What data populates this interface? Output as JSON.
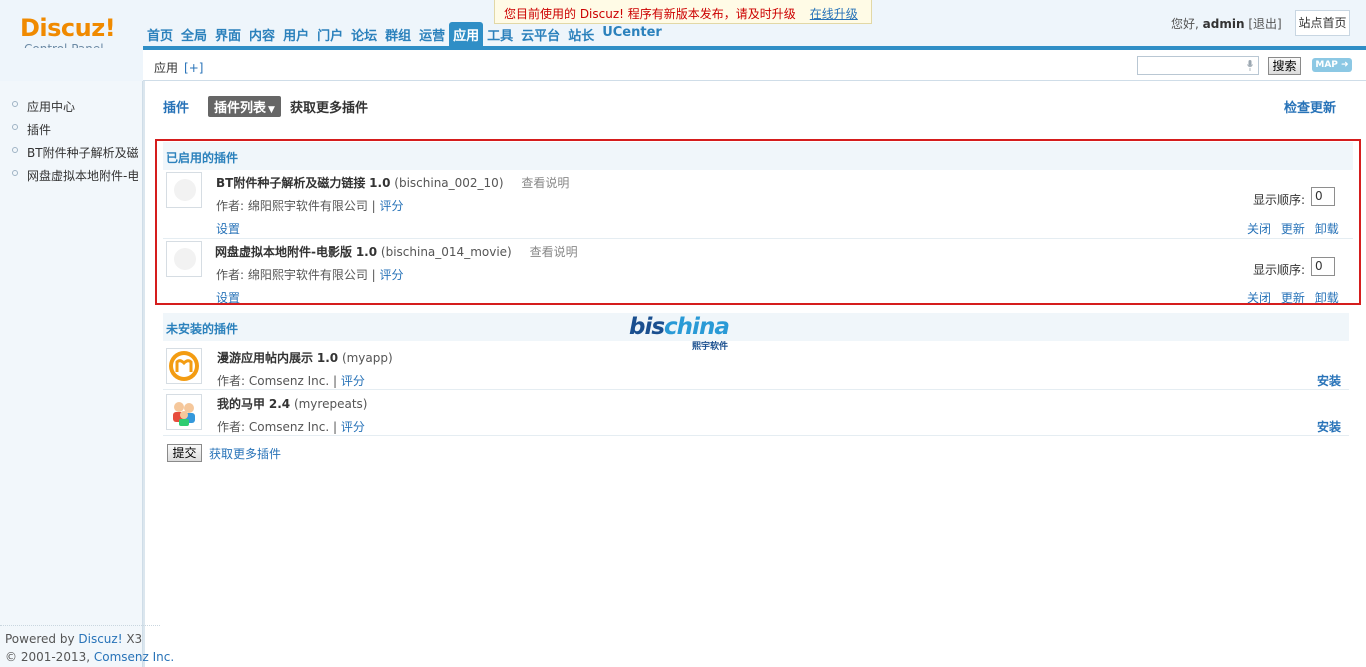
{
  "header": {
    "logo_brand": "Discuz!",
    "logo_sub": "Control Panel",
    "nav": [
      "首页",
      "全局",
      "界面",
      "内容",
      "用户",
      "门户",
      "论坛",
      "群组",
      "运营",
      "应用",
      "工具",
      "云平台",
      "站长",
      "UCenter"
    ],
    "active_nav": "应用",
    "notice_text": "您目前使用的 Discuz! 程序有新版本发布，请及时升级",
    "notice_link": "在线升级",
    "greeting": "您好,",
    "username": "admin",
    "logout": "[退出]",
    "home_link": "站点首页"
  },
  "subbar": {
    "crumb": "应用",
    "crumb_add": "[+]",
    "search_value": "",
    "search_button": "搜索",
    "map_button": "MAP ➜"
  },
  "sidebar": {
    "items": [
      "应用中心",
      "插件",
      "BT附件种子解析及磁",
      "网盘虚拟本地附件-电"
    ],
    "footer_line1_prefix": "Powered by ",
    "footer_line1_link": "Discuz!",
    "footer_line1_suffix": " X3",
    "footer_line2_prefix": "© 2001-2013, ",
    "footer_line2_link": "Comsenz Inc."
  },
  "main": {
    "tab_plugin": "插件",
    "tab_list": "插件列表",
    "tab_more": "获取更多插件",
    "check_update": "检查更新",
    "enabled_title": "已启用的插件",
    "enabled": [
      {
        "name": "BT附件种子解析及磁力链接",
        "version": "1.0",
        "ident": "(bischina_002_10)",
        "readme": "查看说明",
        "author": "作者: 绵阳熙宇软件有限公司 |",
        "rate": "评分",
        "settings": "设置",
        "order_label": "显示顺序:",
        "order": "0",
        "actions": [
          "关闭",
          "更新",
          "卸载"
        ]
      },
      {
        "name": "网盘虚拟本地附件-电影版",
        "version": "1.0",
        "ident": "(bischina_014_movie)",
        "readme": "查看说明",
        "author": "作者: 绵阳熙宇软件有限公司 |",
        "rate": "评分",
        "settings": "设置",
        "order_label": "显示顺序:",
        "order": "0",
        "actions": [
          "关闭",
          "更新",
          "卸载"
        ]
      }
    ],
    "uninstalled_title": "未安装的插件",
    "uninstalled": [
      {
        "name": "漫游应用帖内展示",
        "version": "1.0",
        "ident": "(myapp)",
        "author": "作者: Comsenz Inc. |",
        "rate": "评分",
        "install": "安装"
      },
      {
        "name": "我的马甲",
        "version": "2.4",
        "ident": "(myrepeats)",
        "author": "作者: Comsenz Inc. |",
        "rate": "评分",
        "install": "安装"
      }
    ],
    "watermark_word_1": "bis",
    "watermark_word_2": "china",
    "watermark_cn": "熙宇软件",
    "submit": "提交",
    "more_plugins": "获取更多插件"
  },
  "colors": {
    "link": "#2873b8",
    "brand": "#f08a00",
    "highlight_border": "#d51d1d",
    "nav_active": "#2f8ec6"
  }
}
